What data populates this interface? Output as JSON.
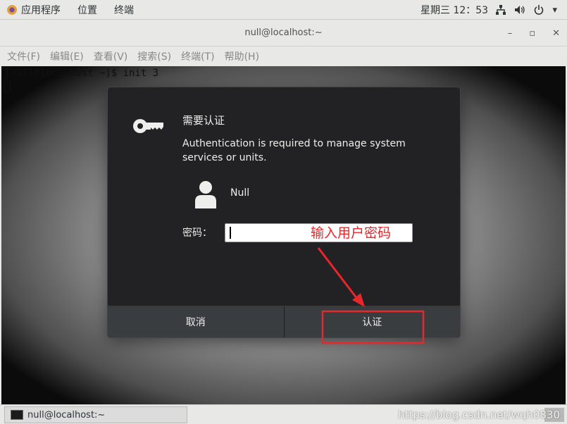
{
  "top_panel": {
    "menus": [
      "应用程序",
      "位置",
      "终端"
    ],
    "clock": "星期三 12：53",
    "tray_icons": [
      "network-icon",
      "volume-icon",
      "power-icon"
    ]
  },
  "terminal": {
    "title": "null@localhost:~",
    "window_buttons": [
      "–",
      "▫",
      "✕"
    ],
    "menu": [
      "文件(F)",
      "编辑(E)",
      "查看(V)",
      "搜索(S)",
      "终端(T)",
      "帮助(H)"
    ],
    "prompt": "[null@localhost ~]$ init 3"
  },
  "dialog": {
    "title": "需要认证",
    "message": "Authentication is required to manage system services or units.",
    "user": "Null",
    "password_label": "密码：",
    "password_value": "",
    "annotation": "输入用户密码",
    "cancel_label": "取消",
    "auth_label": "认证"
  },
  "taskbar": {
    "item": "null@localhost:~",
    "watermark": "https://blog.csdn.net/wqh0830"
  },
  "colors": {
    "annotation_red": "#e8262b",
    "dialog_bg": "#222224",
    "button_bg": "#3a3d40"
  }
}
